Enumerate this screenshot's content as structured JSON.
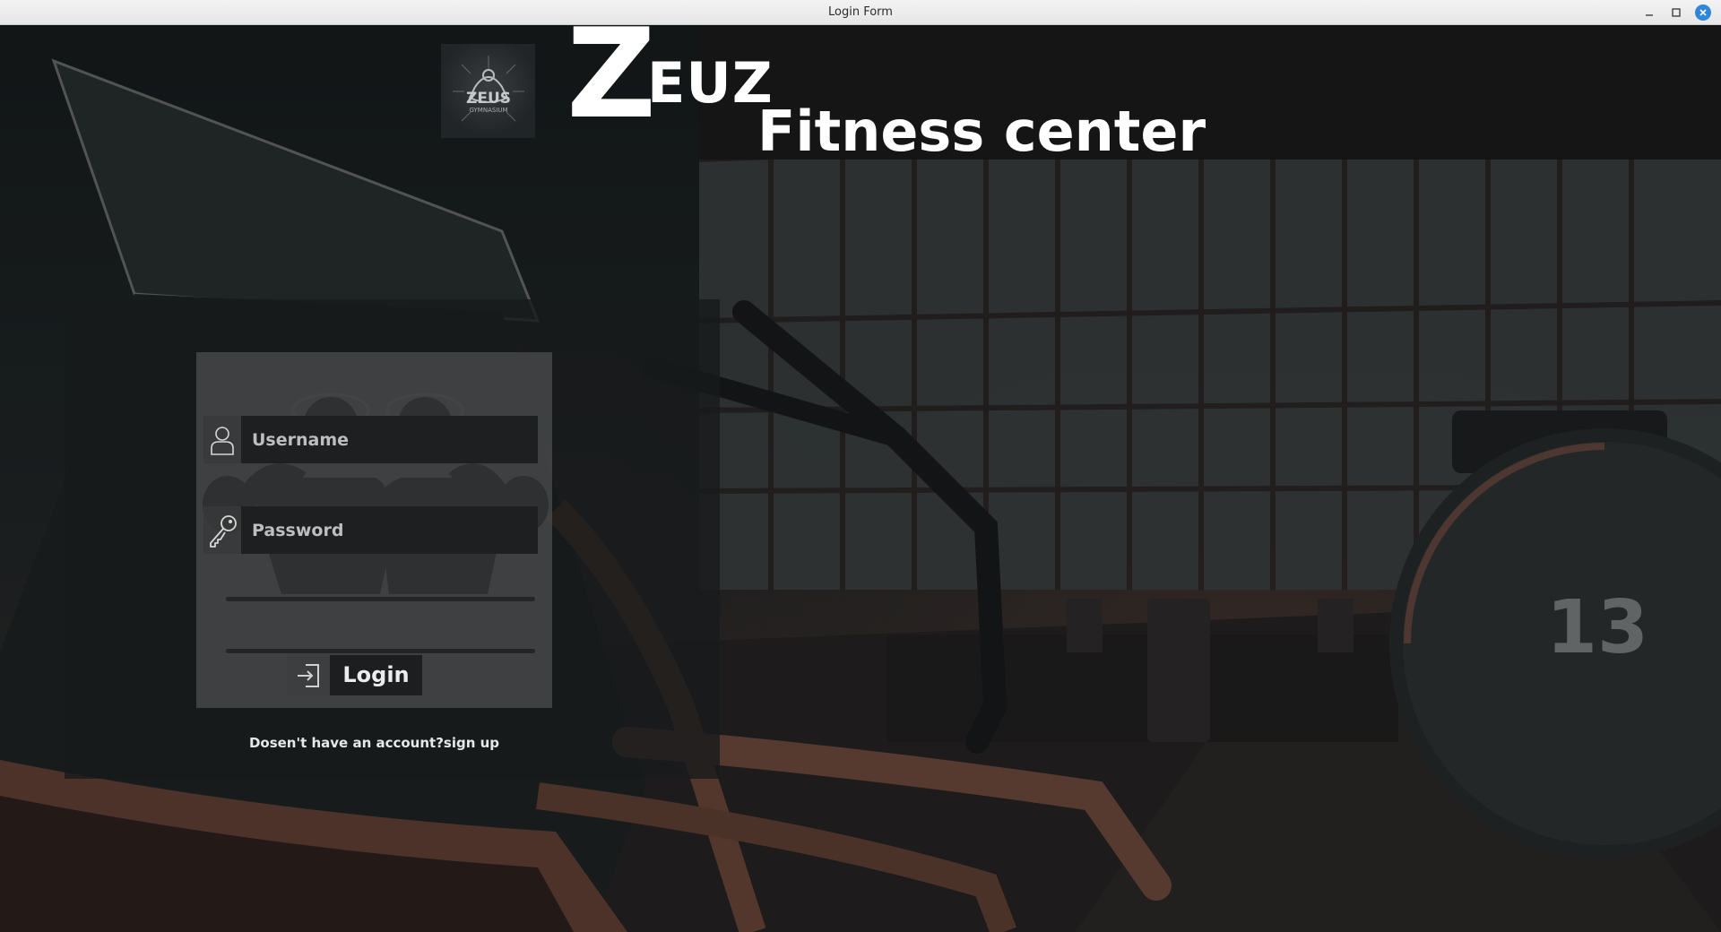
{
  "window": {
    "title": "Login Form",
    "controls": {
      "minimize_icon": "minimize-icon",
      "maximize_icon": "maximize-icon",
      "close_icon": "close-icon"
    }
  },
  "brand": {
    "logo_text": "ZEUS GYMNASIUM",
    "name_initial": "Z",
    "name_rest": "EUZ",
    "subtitle": "Fitness center"
  },
  "scene": {
    "dumbbell_number": "13"
  },
  "login": {
    "username": {
      "placeholder": "Username",
      "value": "",
      "icon": "user-icon"
    },
    "password": {
      "placeholder": "Password",
      "value": "",
      "icon": "key-icon"
    },
    "login_button_label": "Login",
    "login_button_icon": "login-arrow-icon",
    "signup_text": "Dosen't have an account?sign up"
  },
  "colors": {
    "close_button": "#2f87d9",
    "input_background": "#1d1f20",
    "card_background": "#5f6162",
    "accent_copper": "#8a5a48"
  }
}
